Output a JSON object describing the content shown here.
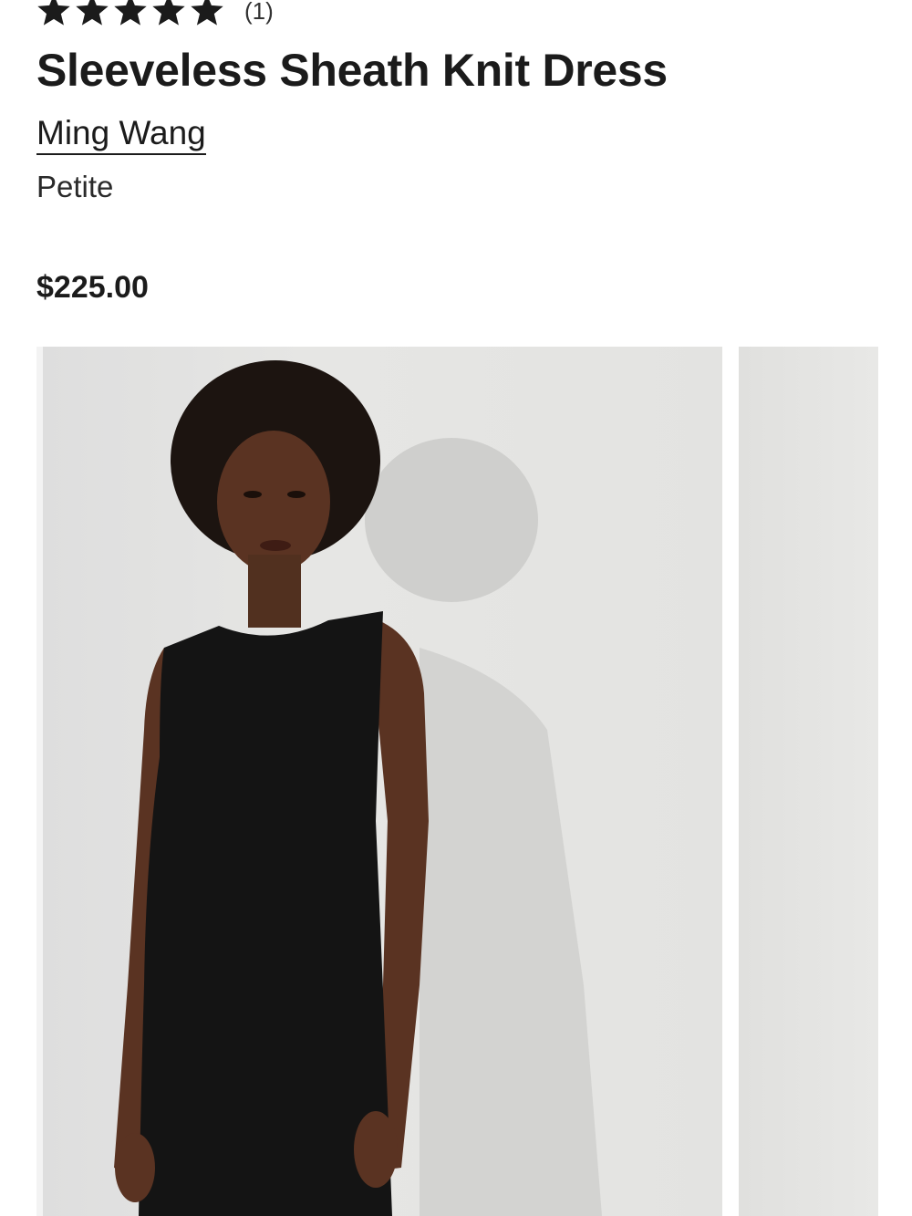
{
  "product": {
    "rating_stars": 5,
    "review_count": "(1)",
    "title": "Sleeveless Sheath Knit Dress",
    "brand": "Ming Wang",
    "size_type": "Petite",
    "price": "$225.00"
  },
  "gallery": {
    "images": [
      {
        "icon": "model-photo-front"
      },
      {
        "icon": "model-photo-next"
      }
    ]
  },
  "colors": {
    "text": "#1b1b1b",
    "photo_background": "#e4e4e2",
    "dress": "#141414",
    "skin": "#5a3322",
    "hair": "#1c1410"
  }
}
